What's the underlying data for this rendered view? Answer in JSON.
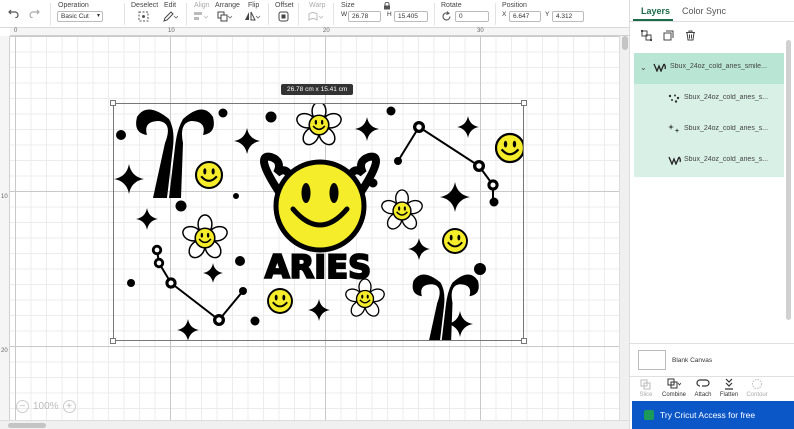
{
  "toolbar": {
    "operation_label": "Operation",
    "operation_value": "Basic Cut",
    "deselect_label": "Deselect",
    "edit_label": "Edit",
    "align_label": "Align",
    "arrange_label": "Arrange",
    "flip_label": "Flip",
    "offset_label": "Offset",
    "warp_label": "Warp",
    "size_label": "Size",
    "width_prefix": "W",
    "width_value": "26.78",
    "height_prefix": "H",
    "height_value": "15.405",
    "rotate_label": "Rotate",
    "rotate_value": "0",
    "position_label": "Position",
    "x_prefix": "X",
    "x_value": "6.647",
    "y_prefix": "Y",
    "y_value": "4.312"
  },
  "rulers": {
    "top": [
      "0",
      "10",
      "20",
      "30"
    ],
    "left": [
      "10",
      "20"
    ]
  },
  "canvas": {
    "size_tooltip": "26.78  cm x 15.41  cm",
    "design_text": "ARIES",
    "zoom_label": "100%",
    "zoom_out_label": "−",
    "zoom_in_label": "+"
  },
  "panel": {
    "tabs": [
      {
        "label": "Layers",
        "active": true
      },
      {
        "label": "Color Sync",
        "active": false
      }
    ],
    "layers": [
      {
        "name": "Sbux_24oz_cold_aries_smile...",
        "icon": "group-thumbnail-icon"
      },
      {
        "name": "Sbux_24oz_cold_aries_s...",
        "icon": "dots-thumbnail-icon"
      },
      {
        "name": "Sbux_24oz_cold_aries_s...",
        "icon": "sparkle-thumbnail-icon"
      },
      {
        "name": "Sbux_24oz_cold_aries_s...",
        "icon": "shape-thumbnail-icon"
      }
    ],
    "blank_canvas_label": "Blank Canvas",
    "actions": [
      {
        "label": "Slice",
        "enabled": false
      },
      {
        "label": "Combine",
        "enabled": true
      },
      {
        "label": "Attach",
        "enabled": true
      },
      {
        "label": "Flatten",
        "enabled": true
      },
      {
        "label": "Contour",
        "enabled": false
      }
    ],
    "cta_label": "Try Cricut Access for free"
  },
  "colors": {
    "accent": "#1b6b4a",
    "layer_highlight": "#d8f0e6",
    "cta_background": "#0c57c8",
    "smiley_yellow": "#f5ec2a"
  }
}
